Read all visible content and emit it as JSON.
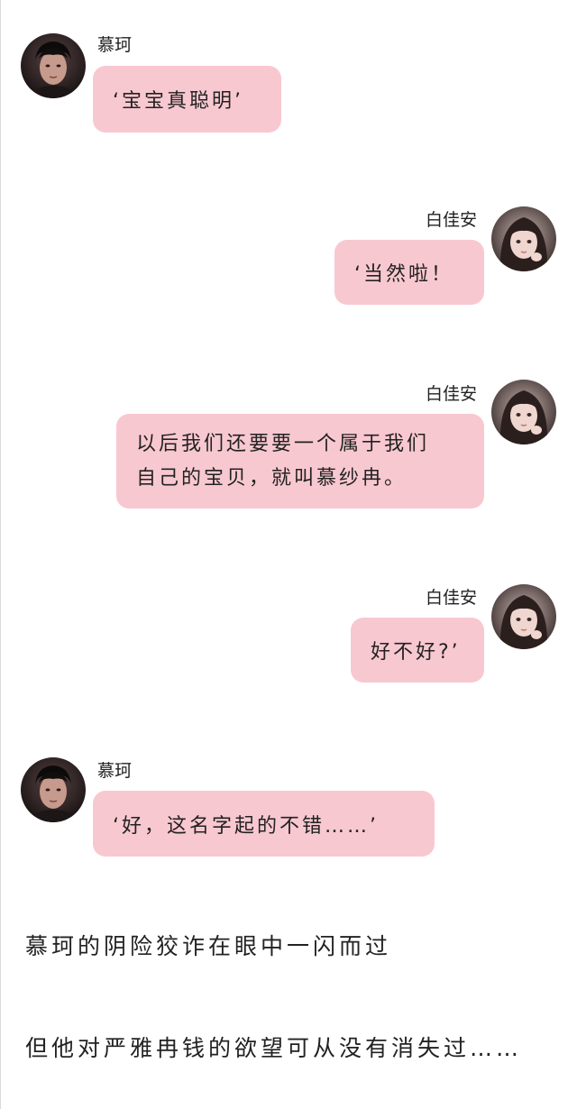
{
  "messages": [
    {
      "sender": "慕珂",
      "side": "left",
      "text": "‘宝宝真聪明’"
    },
    {
      "sender": "白佳安",
      "side": "right",
      "text": "‘当然啦！"
    },
    {
      "sender": "白佳安",
      "side": "right",
      "lines": [
        "以后我们还要要一个属于我们",
        "自己的宝贝，就叫慕纱冉。"
      ]
    },
    {
      "sender": "白佳安",
      "side": "right",
      "text": "好不好?’"
    },
    {
      "sender": "慕珂",
      "side": "left",
      "text": "‘好，这名字起的不错……’"
    }
  ],
  "narration": [
    "慕珂的阴险狡诈在眼中一闪而过",
    "但他对严雅冉钱的欲望可从没有消失过……"
  ],
  "colors": {
    "bubble": "#f8c8d0",
    "background": "#ffffff"
  },
  "icons": {
    "male_avatar": "male-avatar-photo",
    "female_avatar": "female-avatar-photo"
  }
}
